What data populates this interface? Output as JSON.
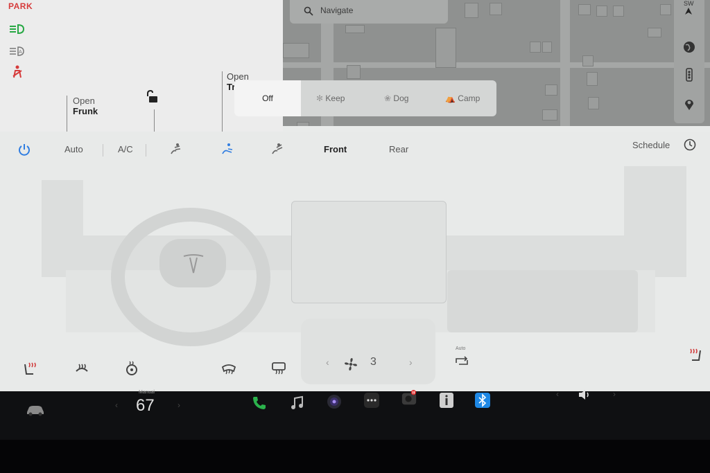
{
  "status": {
    "gear": "PARK",
    "frunk": {
      "line1": "Open",
      "line2": "Frunk"
    },
    "trunk": {
      "line1": "Open",
      "line2": "Tr"
    }
  },
  "map": {
    "search_placeholder": "Navigate",
    "compass": "SW"
  },
  "mode_menu": {
    "items": [
      "Off",
      "Keep",
      "Dog",
      "Camp"
    ],
    "selected": "Off"
  },
  "climate": {
    "auto_label": "Auto",
    "ac_label": "A/C",
    "front_label": "Front",
    "rear_label": "Rear",
    "schedule_label": "Schedule",
    "fan_speed": "3",
    "recirc_auto_label": "Auto"
  },
  "bottom_bar": {
    "temp_mode": "Manual",
    "temperature": "67"
  },
  "colors": {
    "accent_blue": "#2f7de1",
    "warning_red": "#d63b3b",
    "light_green": "#27a844",
    "phone_green": "#2bb24c",
    "seat_heat_red": "#d13a3a"
  }
}
